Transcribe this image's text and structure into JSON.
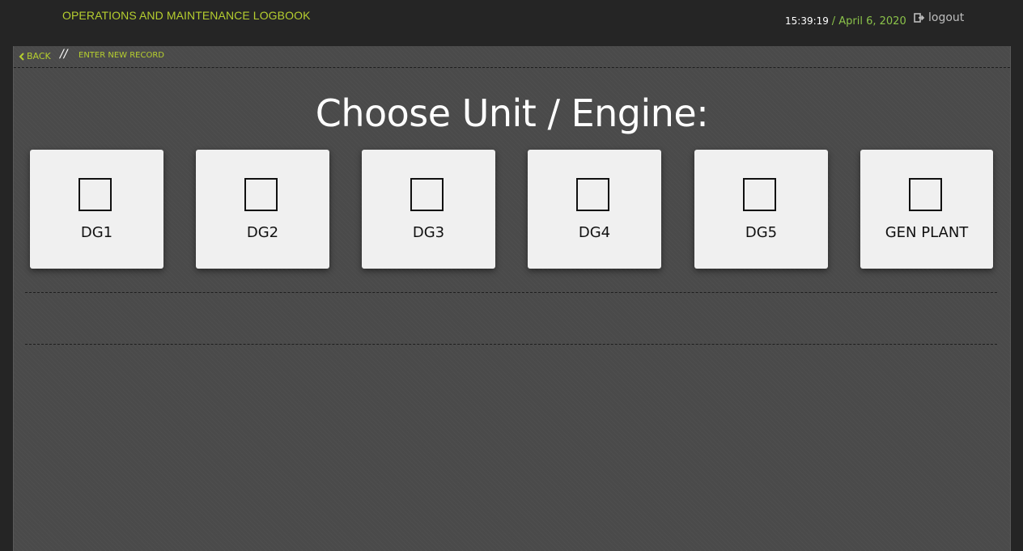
{
  "header": {
    "title": "OPERATIONS AND MAINTENANCE LOGBOOK",
    "time": "15:39:19",
    "date": "/ April 6, 2020",
    "logout_label": "logout",
    "accent_color": "#b6cf2f"
  },
  "breadcrumb": {
    "back_label": "BACK",
    "separator": "//",
    "current": "ENTER NEW RECORD"
  },
  "main": {
    "heading": "Choose Unit / Engine:",
    "units": [
      {
        "label": "DG1",
        "checked": false
      },
      {
        "label": "DG2",
        "checked": false
      },
      {
        "label": "DG3",
        "checked": false
      },
      {
        "label": "DG4",
        "checked": false
      },
      {
        "label": "DG5",
        "checked": false
      },
      {
        "label": "GEN PLANT",
        "checked": false
      }
    ]
  }
}
